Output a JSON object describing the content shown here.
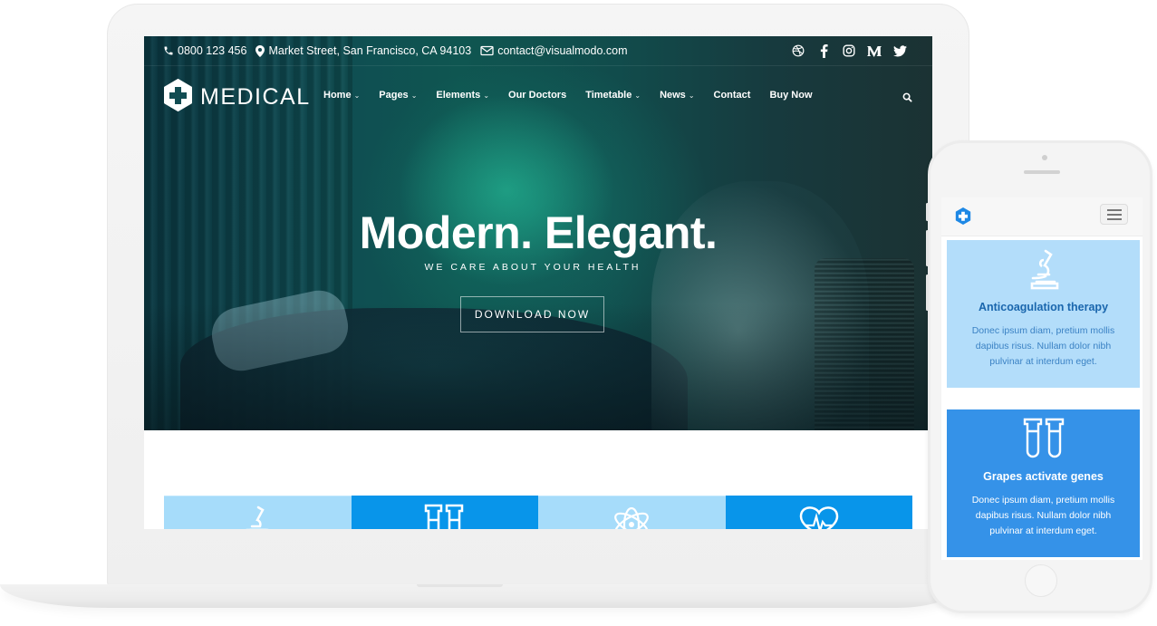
{
  "site": {
    "brand": "MEDICAL",
    "topbar": {
      "phone": "0800 123 456",
      "address": "Market Street, San Francisco, CA 94103",
      "email": "contact@visualmodo.com",
      "social": [
        "dribbble-icon",
        "facebook-icon",
        "instagram-icon",
        "medium-icon",
        "twitter-icon"
      ]
    },
    "nav": {
      "items": [
        {
          "label": "Home",
          "dropdown": true
        },
        {
          "label": "Pages",
          "dropdown": true
        },
        {
          "label": "Elements",
          "dropdown": true
        },
        {
          "label": "Our Doctors",
          "dropdown": false
        },
        {
          "label": "Timetable",
          "dropdown": true
        },
        {
          "label": "News",
          "dropdown": true
        },
        {
          "label": "Contact",
          "dropdown": false
        },
        {
          "label": "Buy Now",
          "dropdown": false
        }
      ],
      "chevron": "⌄",
      "search_icon": "search-icon"
    },
    "hero": {
      "title": "Modern. Elegant.",
      "subtitle": "WE CARE ABOUT YOUR HEALTH",
      "button": "DOWNLOAD NOW"
    },
    "features": [
      {
        "icon": "microscope-icon",
        "style": "light"
      },
      {
        "icon": "test-tubes-icon",
        "style": "dark"
      },
      {
        "icon": "atom-icon",
        "style": "light"
      },
      {
        "icon": "heart-pulse-icon",
        "style": "dark"
      }
    ]
  },
  "mobile": {
    "menu_icon": "hamburger-icon",
    "cards": [
      {
        "title": "Anticoagulation therapy",
        "text": "Donec ipsum diam, pretium mollis dapibus risus. Nullam dolor nibh pulvinar at interdum eget.",
        "icon": "microscope-icon"
      },
      {
        "title": "Grapes activate genes",
        "text": "Donec ipsum diam, pretium mollis dapibus risus. Nullam dolor nibh pulvinar at interdum eget.",
        "icon": "test-tubes-icon"
      }
    ]
  },
  "colors": {
    "feature_light": "#a6dcfa",
    "feature_dark": "#0895ea",
    "mobile_card_light": "#b3ddfa",
    "mobile_card_dark": "#3592e8",
    "brand_blue": "#1e88e5"
  }
}
